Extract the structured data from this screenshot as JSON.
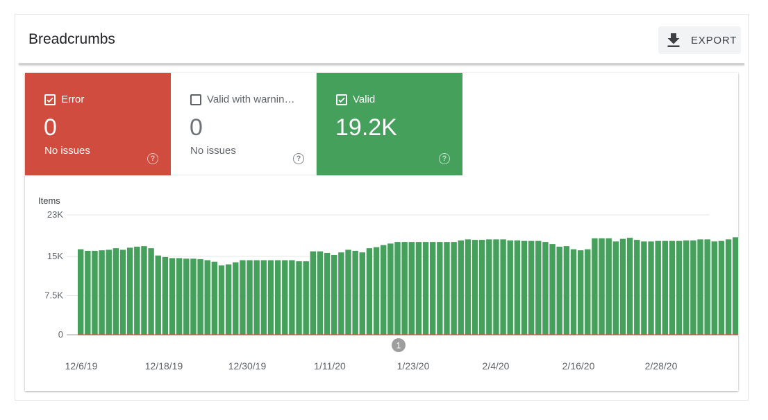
{
  "header": {
    "title": "Breadcrumbs",
    "export_label": "EXPORT",
    "export_icon": "download-icon"
  },
  "tiles": [
    {
      "label": "Error",
      "checked": true,
      "count": "0",
      "sub": "No issues",
      "color": "#d04c3f"
    },
    {
      "label": "Valid with warnin…",
      "checked": false,
      "count": "0",
      "sub": "No issues",
      "color": "#ffffff"
    },
    {
      "label": "Valid",
      "checked": true,
      "count": "19.2K",
      "sub": "",
      "color": "#45a05c"
    }
  ],
  "annotation_badge": "1",
  "chart_data": {
    "type": "bar",
    "ylabel": "Items",
    "ylim": [
      0,
      23000
    ],
    "yticks": [
      "23K",
      "15K",
      "7.5K",
      "0"
    ],
    "ytick_values": [
      23000,
      15000,
      7500,
      0
    ],
    "xticks": [
      "12/6/19",
      "12/18/19",
      "12/30/19",
      "1/11/20",
      "1/23/20",
      "2/4/20",
      "2/16/20",
      "2/28/20"
    ],
    "bar_color": "#45a05c",
    "error_line_color": "#d04c3f",
    "series": [
      {
        "name": "Valid",
        "values": [
          16400,
          16100,
          16100,
          16200,
          16300,
          16600,
          16300,
          16700,
          16900,
          17000,
          16600,
          15200,
          14900,
          14700,
          14700,
          14600,
          14600,
          14500,
          14300,
          14000,
          13300,
          13500,
          13900,
          14300,
          14300,
          14300,
          14300,
          14300,
          14300,
          14300,
          14300,
          14100,
          14100,
          16000,
          16000,
          15700,
          15300,
          15800,
          16300,
          16100,
          15800,
          16600,
          16800,
          17200,
          17500,
          17800,
          17800,
          17800,
          17800,
          17800,
          17800,
          17800,
          17800,
          17800,
          18100,
          18300,
          18200,
          18200,
          18300,
          18300,
          18300,
          18100,
          18100,
          18000,
          18000,
          18000,
          17800,
          17400,
          16900,
          17000,
          16400,
          16200,
          16400,
          18500,
          18500,
          18500,
          17900,
          18400,
          18600,
          18200,
          17900,
          17900,
          18000,
          18000,
          18000,
          18000,
          18100,
          18100,
          18300,
          18300,
          17900,
          18000,
          18300,
          18700,
          18900,
          19200,
          19200,
          19400
        ]
      }
    ]
  }
}
